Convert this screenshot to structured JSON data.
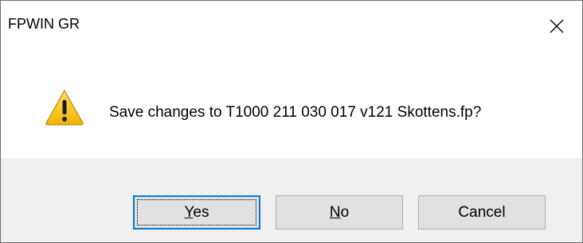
{
  "window": {
    "title": "FPWIN GR"
  },
  "icons": {
    "close": "close-icon",
    "warning": "warning-icon"
  },
  "message": {
    "text": "Save changes to T1000 211 030 017 v121 Skottens.fp?"
  },
  "buttons": {
    "yes": {
      "accel": "Y",
      "rest": "es"
    },
    "no": {
      "accel": "N",
      "rest": "o"
    },
    "cancel": {
      "label": "Cancel"
    }
  },
  "colors": {
    "button_bar": "#f0f0f0",
    "default_button_border": "#0078d7",
    "warning_yellow": "#f5c518"
  }
}
